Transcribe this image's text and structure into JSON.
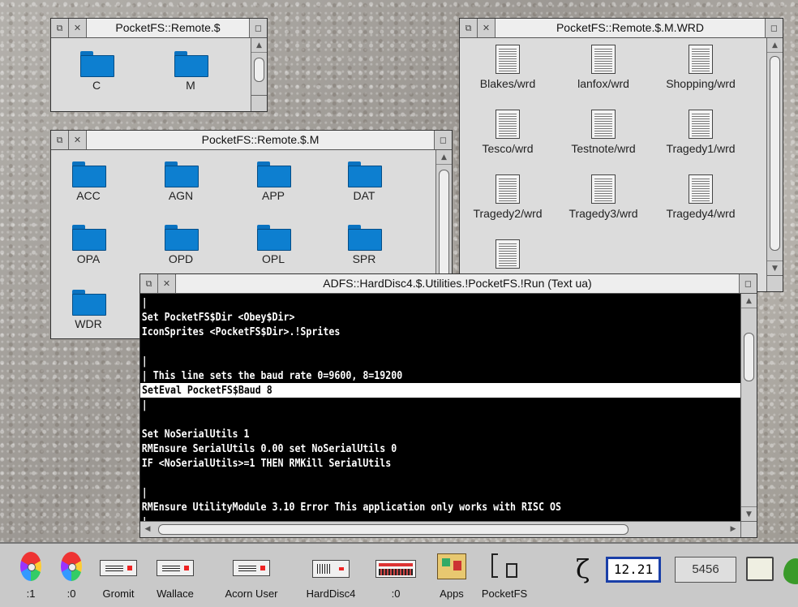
{
  "windows": {
    "remote_root": {
      "title": "PocketFS::Remote.$",
      "items": [
        "C",
        "M"
      ]
    },
    "remote_m": {
      "title": "PocketFS::Remote.$.M",
      "items": [
        "ACC",
        "AGN",
        "APP",
        "DAT",
        "OPA",
        "OPD",
        "OPL",
        "SPR",
        "WDR"
      ]
    },
    "remote_wrd": {
      "title": "PocketFS::Remote.$.M.WRD",
      "items": [
        "Blakes/wrd",
        "lanfox/wrd",
        "Shopping/wrd",
        "Tesco/wrd",
        "Testnote/wrd",
        "Tragedy1/wrd",
        "Tragedy2/wrd",
        "Tragedy3/wrd",
        "Tragedy4/wrd",
        ""
      ]
    },
    "editor": {
      "title": "ADFS::HardDisc4.$.Utilities.!PocketFS.!Run (Text ua)",
      "lines": [
        "|",
        "Set PocketFS$Dir <Obey$Dir>",
        "IconSprites <PocketFS$Dir>.!Sprites",
        "",
        "|",
        "| This line sets the baud rate 0=9600, 8=19200",
        "SetEval PocketFS$Baud 8",
        "|",
        "",
        "Set NoSerialUtils 1",
        "RMEnsure SerialUtils 0.00 set NoSerialUtils 0",
        "IF <NoSerialUtils>=1 THEN RMKill SerialUtils",
        "",
        "|",
        "RMEnsure UtilityModule 3.10 Error This application only works with RISC OS",
        "|"
      ],
      "selected_line": 6
    }
  },
  "window_controls": {
    "back_glyph": "⧉",
    "close_glyph": "✕",
    "toggle_glyph": "◻",
    "up_glyph": "▲",
    "down_glyph": "▼",
    "left_glyph": "◀",
    "right_glyph": "▶"
  },
  "iconbar": {
    "items": [
      {
        "label": ":1",
        "icon": "cd-disc-icon"
      },
      {
        "label": ":0",
        "icon": "cd-disc-icon"
      },
      {
        "label": "Gromit",
        "icon": "drive-icon"
      },
      {
        "label": "Wallace",
        "icon": "drive-icon"
      },
      {
        "label": "Acorn User",
        "icon": "drive-icon"
      },
      {
        "label": "HardDisc4",
        "icon": "harddisc-icon"
      },
      {
        "label": ":0",
        "icon": "ram-disc-icon"
      },
      {
        "label": "Apps",
        "icon": "apps-icon"
      },
      {
        "label": "PocketFS",
        "icon": "pocketfs-icon"
      }
    ],
    "zeta_glyph": "ζ",
    "clock": "12.21",
    "free_memory": "5456"
  }
}
